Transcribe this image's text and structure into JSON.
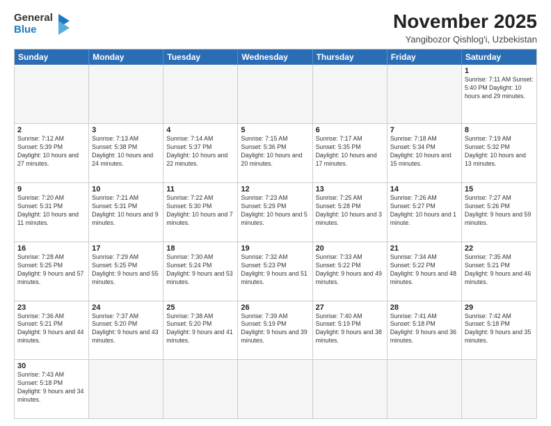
{
  "header": {
    "logo_general": "General",
    "logo_blue": "Blue",
    "month_title": "November 2025",
    "location": "Yangibozor Qishlog'i, Uzbekistan"
  },
  "weekdays": [
    "Sunday",
    "Monday",
    "Tuesday",
    "Wednesday",
    "Thursday",
    "Friday",
    "Saturday"
  ],
  "weeks": [
    [
      {
        "day": "",
        "info": ""
      },
      {
        "day": "",
        "info": ""
      },
      {
        "day": "",
        "info": ""
      },
      {
        "day": "",
        "info": ""
      },
      {
        "day": "",
        "info": ""
      },
      {
        "day": "",
        "info": ""
      },
      {
        "day": "1",
        "info": "Sunrise: 7:11 AM\nSunset: 5:40 PM\nDaylight: 10 hours and 29 minutes."
      }
    ],
    [
      {
        "day": "2",
        "info": "Sunrise: 7:12 AM\nSunset: 5:39 PM\nDaylight: 10 hours and 27 minutes."
      },
      {
        "day": "3",
        "info": "Sunrise: 7:13 AM\nSunset: 5:38 PM\nDaylight: 10 hours and 24 minutes."
      },
      {
        "day": "4",
        "info": "Sunrise: 7:14 AM\nSunset: 5:37 PM\nDaylight: 10 hours and 22 minutes."
      },
      {
        "day": "5",
        "info": "Sunrise: 7:15 AM\nSunset: 5:36 PM\nDaylight: 10 hours and 20 minutes."
      },
      {
        "day": "6",
        "info": "Sunrise: 7:17 AM\nSunset: 5:35 PM\nDaylight: 10 hours and 17 minutes."
      },
      {
        "day": "7",
        "info": "Sunrise: 7:18 AM\nSunset: 5:34 PM\nDaylight: 10 hours and 15 minutes."
      },
      {
        "day": "8",
        "info": "Sunrise: 7:19 AM\nSunset: 5:32 PM\nDaylight: 10 hours and 13 minutes."
      }
    ],
    [
      {
        "day": "9",
        "info": "Sunrise: 7:20 AM\nSunset: 5:31 PM\nDaylight: 10 hours and 11 minutes."
      },
      {
        "day": "10",
        "info": "Sunrise: 7:21 AM\nSunset: 5:31 PM\nDaylight: 10 hours and 9 minutes."
      },
      {
        "day": "11",
        "info": "Sunrise: 7:22 AM\nSunset: 5:30 PM\nDaylight: 10 hours and 7 minutes."
      },
      {
        "day": "12",
        "info": "Sunrise: 7:23 AM\nSunset: 5:29 PM\nDaylight: 10 hours and 5 minutes."
      },
      {
        "day": "13",
        "info": "Sunrise: 7:25 AM\nSunset: 5:28 PM\nDaylight: 10 hours and 3 minutes."
      },
      {
        "day": "14",
        "info": "Sunrise: 7:26 AM\nSunset: 5:27 PM\nDaylight: 10 hours and 1 minute."
      },
      {
        "day": "15",
        "info": "Sunrise: 7:27 AM\nSunset: 5:26 PM\nDaylight: 9 hours and 59 minutes."
      }
    ],
    [
      {
        "day": "16",
        "info": "Sunrise: 7:28 AM\nSunset: 5:25 PM\nDaylight: 9 hours and 57 minutes."
      },
      {
        "day": "17",
        "info": "Sunrise: 7:29 AM\nSunset: 5:25 PM\nDaylight: 9 hours and 55 minutes."
      },
      {
        "day": "18",
        "info": "Sunrise: 7:30 AM\nSunset: 5:24 PM\nDaylight: 9 hours and 53 minutes."
      },
      {
        "day": "19",
        "info": "Sunrise: 7:32 AM\nSunset: 5:23 PM\nDaylight: 9 hours and 51 minutes."
      },
      {
        "day": "20",
        "info": "Sunrise: 7:33 AM\nSunset: 5:22 PM\nDaylight: 9 hours and 49 minutes."
      },
      {
        "day": "21",
        "info": "Sunrise: 7:34 AM\nSunset: 5:22 PM\nDaylight: 9 hours and 48 minutes."
      },
      {
        "day": "22",
        "info": "Sunrise: 7:35 AM\nSunset: 5:21 PM\nDaylight: 9 hours and 46 minutes."
      }
    ],
    [
      {
        "day": "23",
        "info": "Sunrise: 7:36 AM\nSunset: 5:21 PM\nDaylight: 9 hours and 44 minutes."
      },
      {
        "day": "24",
        "info": "Sunrise: 7:37 AM\nSunset: 5:20 PM\nDaylight: 9 hours and 43 minutes."
      },
      {
        "day": "25",
        "info": "Sunrise: 7:38 AM\nSunset: 5:20 PM\nDaylight: 9 hours and 41 minutes."
      },
      {
        "day": "26",
        "info": "Sunrise: 7:39 AM\nSunset: 5:19 PM\nDaylight: 9 hours and 39 minutes."
      },
      {
        "day": "27",
        "info": "Sunrise: 7:40 AM\nSunset: 5:19 PM\nDaylight: 9 hours and 38 minutes."
      },
      {
        "day": "28",
        "info": "Sunrise: 7:41 AM\nSunset: 5:18 PM\nDaylight: 9 hours and 36 minutes."
      },
      {
        "day": "29",
        "info": "Sunrise: 7:42 AM\nSunset: 5:18 PM\nDaylight: 9 hours and 35 minutes."
      }
    ],
    [
      {
        "day": "30",
        "info": "Sunrise: 7:43 AM\nSunset: 5:18 PM\nDaylight: 9 hours and 34 minutes."
      },
      {
        "day": "",
        "info": ""
      },
      {
        "day": "",
        "info": ""
      },
      {
        "day": "",
        "info": ""
      },
      {
        "day": "",
        "info": ""
      },
      {
        "day": "",
        "info": ""
      },
      {
        "day": "",
        "info": ""
      }
    ]
  ]
}
